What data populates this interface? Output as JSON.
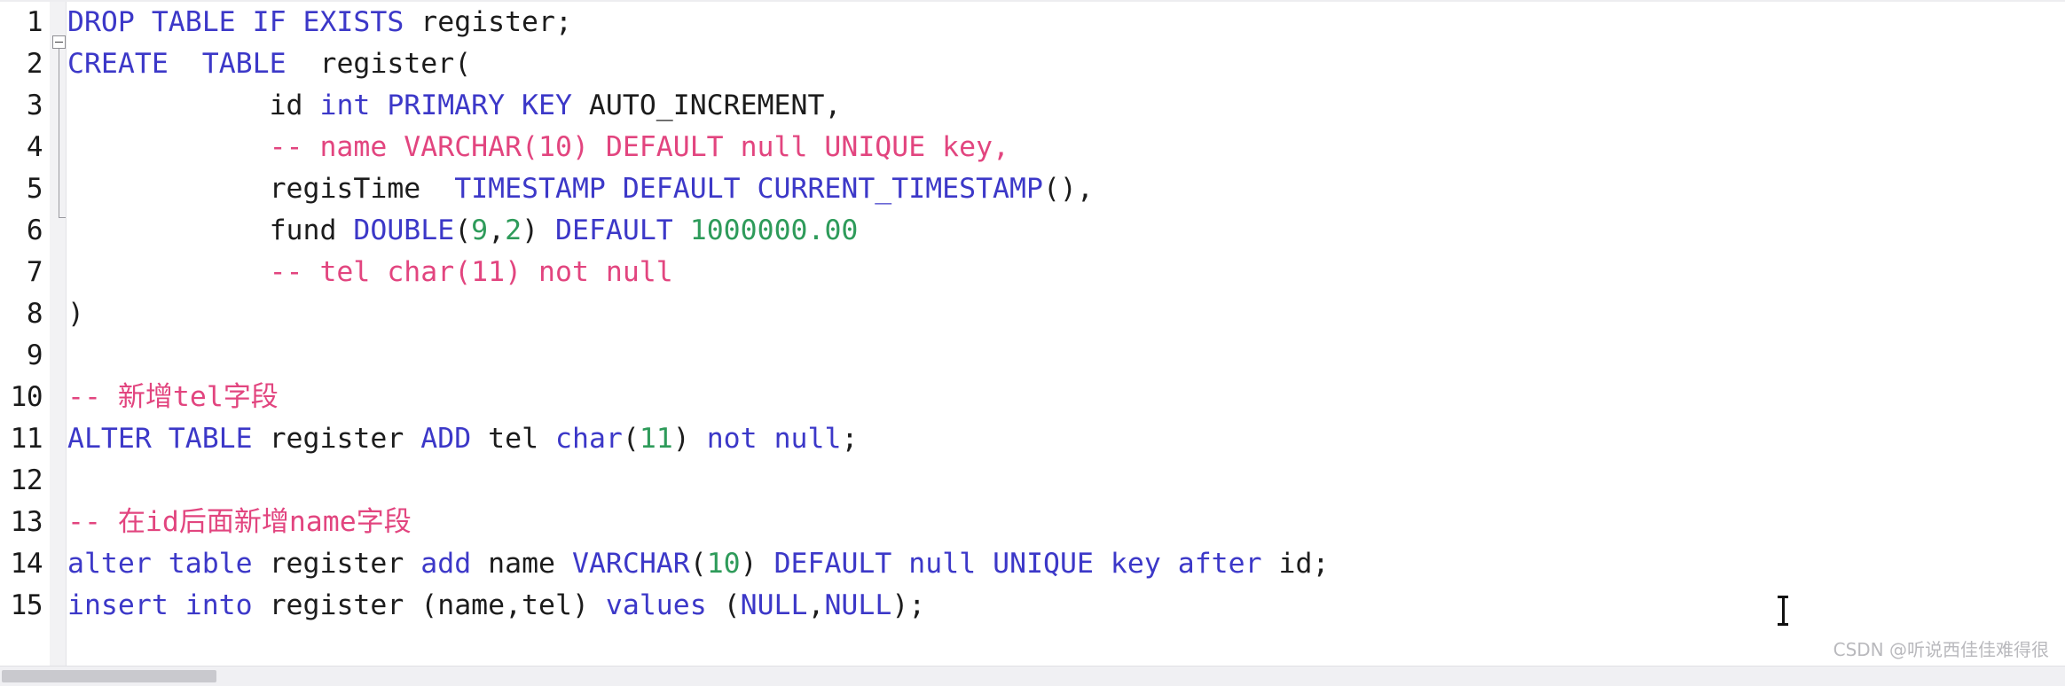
{
  "editor": {
    "language": "sql",
    "colors": {
      "keyword": "#3c38c8",
      "identifier": "#1c1c1c",
      "comment": "#e2457f",
      "number": "#2e9b5a",
      "gutter_background": "#f2f2f4",
      "editor_background": "#ffffff"
    },
    "line_numbers": [
      "1",
      "2",
      "3",
      "4",
      "5",
      "6",
      "7",
      "8",
      "9",
      "10",
      "11",
      "12",
      "13",
      "14",
      "15"
    ],
    "fold_marker": "collapse-minus",
    "lines": [
      {
        "number": "1",
        "indent": "",
        "text": "DROP TABLE IF EXISTS register;",
        "tokens": [
          {
            "t": "DROP TABLE IF EXISTS",
            "c": "kw"
          },
          {
            "t": " register;",
            "c": "id"
          }
        ]
      },
      {
        "number": "2",
        "indent": "",
        "text": "CREATE  TABLE  register(",
        "tokens": [
          {
            "t": "CREATE",
            "c": "kw"
          },
          {
            "t": "  ",
            "c": "id"
          },
          {
            "t": "TABLE",
            "c": "kw"
          },
          {
            "t": "  register(",
            "c": "id"
          }
        ]
      },
      {
        "number": "3",
        "indent": "            ",
        "text": "            id int PRIMARY KEY AUTO_INCREMENT,",
        "tokens": [
          {
            "t": "            id ",
            "c": "id"
          },
          {
            "t": "int PRIMARY KEY",
            "c": "kw"
          },
          {
            "t": " AUTO_INCREMENT,",
            "c": "id"
          }
        ]
      },
      {
        "number": "4",
        "indent": "            ",
        "text": "            -- name VARCHAR(10) DEFAULT null UNIQUE key,",
        "tokens": [
          {
            "t": "            ",
            "c": "id"
          },
          {
            "t": "-- name VARCHAR(10) DEFAULT null UNIQUE key,",
            "c": "cm"
          }
        ]
      },
      {
        "number": "5",
        "indent": "            ",
        "text": "            regisTime  TIMESTAMP DEFAULT CURRENT_TIMESTAMP(),",
        "tokens": [
          {
            "t": "            regisTime  ",
            "c": "id"
          },
          {
            "t": "TIMESTAMP DEFAULT CURRENT_TIMESTAMP",
            "c": "kw"
          },
          {
            "t": "(),",
            "c": "id"
          }
        ]
      },
      {
        "number": "6",
        "indent": "            ",
        "text": "            fund DOUBLE(9,2) DEFAULT 1000000.00",
        "tokens": [
          {
            "t": "            fund ",
            "c": "id"
          },
          {
            "t": "DOUBLE",
            "c": "kw"
          },
          {
            "t": "(",
            "c": "id"
          },
          {
            "t": "9",
            "c": "num"
          },
          {
            "t": ",",
            "c": "id"
          },
          {
            "t": "2",
            "c": "num"
          },
          {
            "t": ") ",
            "c": "id"
          },
          {
            "t": "DEFAULT",
            "c": "kw"
          },
          {
            "t": " ",
            "c": "id"
          },
          {
            "t": "1000000.00",
            "c": "num"
          }
        ]
      },
      {
        "number": "7",
        "indent": "            ",
        "text": "            -- tel char(11) not null",
        "tokens": [
          {
            "t": "            ",
            "c": "id"
          },
          {
            "t": "-- tel char(11) not null",
            "c": "cm"
          }
        ]
      },
      {
        "number": "8",
        "indent": "",
        "text": ")",
        "tokens": [
          {
            "t": ")",
            "c": "id"
          }
        ]
      },
      {
        "number": "9",
        "indent": "",
        "text": "",
        "tokens": []
      },
      {
        "number": "10",
        "indent": "",
        "text": "-- 新增tel字段",
        "tokens": [
          {
            "t": "-- ",
            "c": "cm"
          },
          {
            "t": "新增",
            "c": "cm cjk"
          },
          {
            "t": "tel",
            "c": "cm"
          },
          {
            "t": "字段",
            "c": "cm cjk"
          }
        ]
      },
      {
        "number": "11",
        "indent": "",
        "text": "ALTER TABLE register ADD tel char(11) not null;",
        "tokens": [
          {
            "t": "ALTER TABLE",
            "c": "kw"
          },
          {
            "t": " register ",
            "c": "id"
          },
          {
            "t": "ADD",
            "c": "kw"
          },
          {
            "t": " tel ",
            "c": "id"
          },
          {
            "t": "char",
            "c": "kw"
          },
          {
            "t": "(",
            "c": "id"
          },
          {
            "t": "11",
            "c": "num"
          },
          {
            "t": ") ",
            "c": "id"
          },
          {
            "t": "not null",
            "c": "kw"
          },
          {
            "t": ";",
            "c": "id"
          }
        ]
      },
      {
        "number": "12",
        "indent": "",
        "text": "",
        "tokens": []
      },
      {
        "number": "13",
        "indent": "",
        "text": "-- 在id后面新增name字段",
        "tokens": [
          {
            "t": "-- ",
            "c": "cm"
          },
          {
            "t": "在",
            "c": "cm cjk"
          },
          {
            "t": "id",
            "c": "cm"
          },
          {
            "t": "后面新增",
            "c": "cm cjk"
          },
          {
            "t": "name",
            "c": "cm"
          },
          {
            "t": "字段",
            "c": "cm cjk"
          }
        ]
      },
      {
        "number": "14",
        "indent": "",
        "text": "alter table register add name VARCHAR(10) DEFAULT null UNIQUE key after id;",
        "tokens": [
          {
            "t": "alter table",
            "c": "kw"
          },
          {
            "t": " register ",
            "c": "id"
          },
          {
            "t": "add",
            "c": "kw"
          },
          {
            "t": " name ",
            "c": "id"
          },
          {
            "t": "VARCHAR",
            "c": "kw"
          },
          {
            "t": "(",
            "c": "id"
          },
          {
            "t": "10",
            "c": "num"
          },
          {
            "t": ") ",
            "c": "id"
          },
          {
            "t": "DEFAULT null UNIQUE key after",
            "c": "kw"
          },
          {
            "t": " id;",
            "c": "id"
          }
        ]
      },
      {
        "number": "15",
        "indent": "",
        "text": "insert into register (name,tel) values (NULL,NULL);",
        "tokens": [
          {
            "t": "insert into",
            "c": "kw"
          },
          {
            "t": " register (name,tel) ",
            "c": "id"
          },
          {
            "t": "values",
            "c": "kw"
          },
          {
            "t": " (",
            "c": "id"
          },
          {
            "t": "NULL",
            "c": "kw"
          },
          {
            "t": ",",
            "c": "id"
          },
          {
            "t": "NULL",
            "c": "kw"
          },
          {
            "t": ");",
            "c": "id"
          }
        ]
      }
    ]
  },
  "caret": {
    "label": "text-cursor",
    "line": "14",
    "after_text": "afte"
  },
  "watermark": {
    "text": "CSDN @听说西佳佳难得很"
  },
  "scrollbar": {
    "orientation": "horizontal",
    "thumb_label": "horizontal-scroll-thumb"
  }
}
